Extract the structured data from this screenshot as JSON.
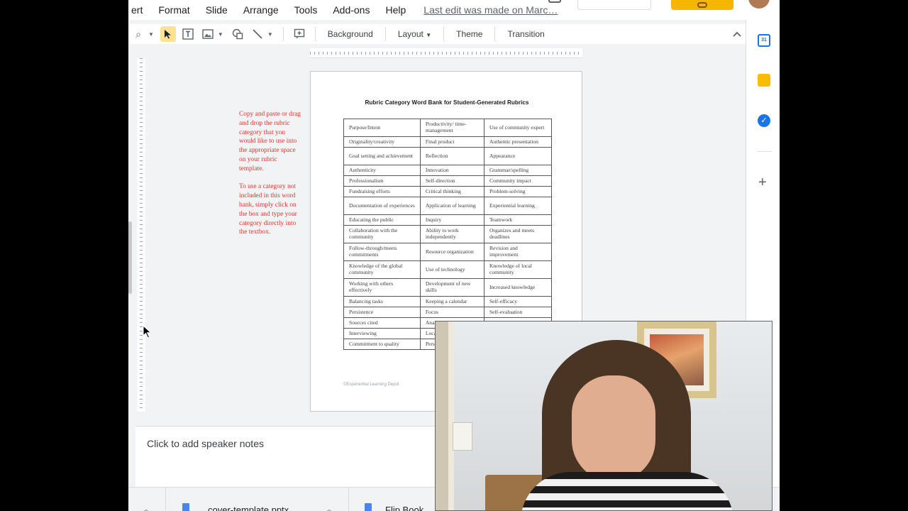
{
  "menubar": {
    "items": [
      "ert",
      "Format",
      "Slide",
      "Arrange",
      "Tools",
      "Add-ons",
      "Help"
    ],
    "last_edit": "Last edit was made on Marc…"
  },
  "toolbar": {
    "background": "Background",
    "layout": "Layout",
    "theme": "Theme",
    "transition": "Transition"
  },
  "instructions": {
    "p1": "Copy and paste or drag and drop the rubric category that you would like to use into the appropriate space on your rubric template.",
    "p2": "To use a category not included in this word bank, simply click on the box and type your category directly into the textbox."
  },
  "slide": {
    "title": "Rubric Category Word Bank for Student-Generated Rubrics",
    "rows": [
      [
        "Purpose/Intent",
        "Productivity/ time-management",
        "Use of community expert"
      ],
      [
        "Originality/creativity",
        "Final product",
        "Authentic presentation"
      ],
      [
        "Goal setting and achievement",
        "Reflection",
        "Appearance"
      ],
      [
        "Authenticity",
        "Innovation",
        "Grammar/spelling"
      ],
      [
        "Professionalism",
        "Self-direction",
        "Community impact"
      ],
      [
        "Fundraising efforts",
        "Critical thinking",
        "Problem-solving"
      ],
      [
        "Documentation of experiences",
        "Application of learning",
        "Experiential learning"
      ],
      [
        "Educating the public",
        "Inquiry",
        "Teamwork"
      ],
      [
        "Collaboration with the community",
        "Ability to work independently",
        "Organizes and meets deadlines"
      ],
      [
        "Follow-through/meets commitments",
        "Resource organization",
        "Revision and improvement"
      ],
      [
        "Knowledge of the global community",
        "Use of technology",
        "Knowledge of local community"
      ],
      [
        "Working with others effectively",
        "Development of new skills",
        "Increased knowledge"
      ],
      [
        "Balancing tasks",
        "Keeping a calendar",
        "Self-efficacy"
      ],
      [
        "Persistence",
        "Focus",
        "Self-evaluation"
      ],
      [
        "Sources cited",
        "Analyti",
        ""
      ],
      [
        "Interviewing",
        "Locati organiz",
        ""
      ],
      [
        "Commitment to quality",
        "Persona",
        ""
      ]
    ],
    "footer": "©Experiential Learning Depot"
  },
  "notes": {
    "placeholder": "Click to add speaker notes"
  },
  "downloads": {
    "file1": "cover-template.pptx",
    "file2": "Flip Book"
  },
  "colors": {
    "instruction_red": "#e8312a",
    "share_yellow": "#f6b500",
    "select_highlight": "#fde293"
  }
}
